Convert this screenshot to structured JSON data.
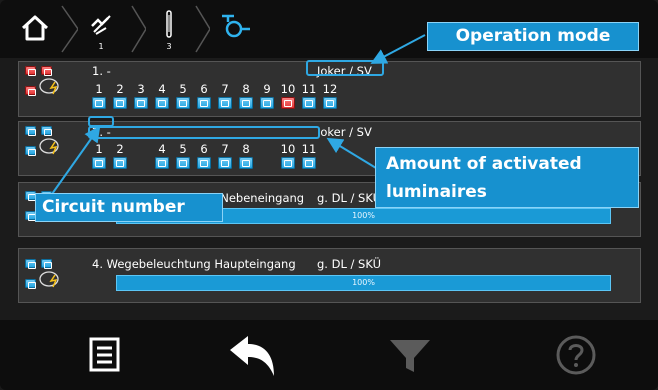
{
  "breadcrumb": {
    "items": [
      {
        "icon": "home-icon"
      },
      {
        "icon": "no-light-icon",
        "count": "1"
      },
      {
        "icon": "luminaire-icon",
        "count": "3"
      },
      {
        "icon": "operation-mode-icon"
      }
    ]
  },
  "circuits": [
    {
      "title": "1. -",
      "mode": "Joker / SV",
      "numbers": [
        "1",
        "2",
        "3",
        "4",
        "5",
        "6",
        "7",
        "8",
        "9",
        "10",
        "11",
        "12"
      ]
    },
    {
      "title": "2. -",
      "mode": "Joker / SV",
      "numbers": [
        "1",
        "2",
        "4",
        "5",
        "6",
        "7",
        "8",
        "10",
        "11"
      ]
    },
    {
      "title": "3. Wegebel. Parkplatz Nebeneingang",
      "mode": "g. DL / SKÜ",
      "progress_label": "100%",
      "progress": 1.0
    },
    {
      "title": "4. Wegebeleuchtung Haupteingang",
      "mode": "g. DL / SKÜ",
      "progress_label": "100%",
      "progress": 1.0
    }
  ],
  "callouts": {
    "operation_mode": "Operation mode",
    "amount": "Amount of activated luminaires",
    "circuit_number": "Circuit number"
  },
  "bottom_bar": {
    "icons": [
      "list-icon",
      "back-icon",
      "filter-icon",
      "help-icon"
    ]
  },
  "colors": {
    "accent": "#1791cf",
    "luminaire_red": "#e02a2a"
  }
}
